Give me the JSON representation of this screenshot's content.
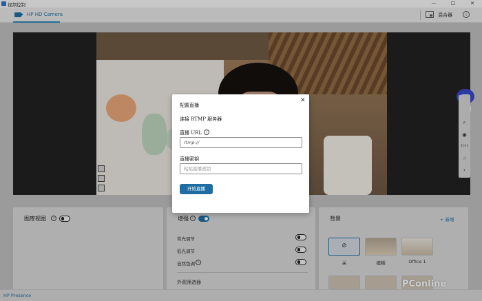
{
  "window": {
    "title": "视频控制",
    "minimize": "—",
    "maximize": "☐",
    "close": "✕"
  },
  "tabbar": {
    "camera_tab": "HP HD Camera",
    "mixer_label": "混合器",
    "info": "i"
  },
  "preview": {
    "tools": [
      "⌗",
      "⌗",
      "⧉"
    ]
  },
  "rail": {
    "icons": [
      "⌕",
      "◉",
      "((·))",
      "☝",
      "›"
    ]
  },
  "panels": {
    "gallery": {
      "title": "图库视图",
      "info": "i"
    },
    "enhance": {
      "title": "增强",
      "info": "i",
      "rows": [
        {
          "label": "背光调节"
        },
        {
          "label": "低光调节"
        },
        {
          "label": "自然色调"
        }
      ],
      "filters_label": "外观筛选器"
    },
    "background": {
      "title": "背景",
      "add_label": "+ 新增",
      "items": [
        {
          "label": "关",
          "symbol": "⊘"
        },
        {
          "label": "模糊"
        },
        {
          "label": "Office 1"
        }
      ]
    }
  },
  "modal": {
    "title": "配置直播",
    "close": "✕",
    "subtitle": "连接 RTMP 服务器",
    "url_label": "直播 URL",
    "url_info": "i",
    "url_value": "rtmp://",
    "key_label": "直播密钥",
    "key_placeholder": "粘贴直播密钥",
    "start_button": "开始直播"
  },
  "statusbar": {
    "app_name": "HP Presence"
  },
  "watermark": "PConline"
}
